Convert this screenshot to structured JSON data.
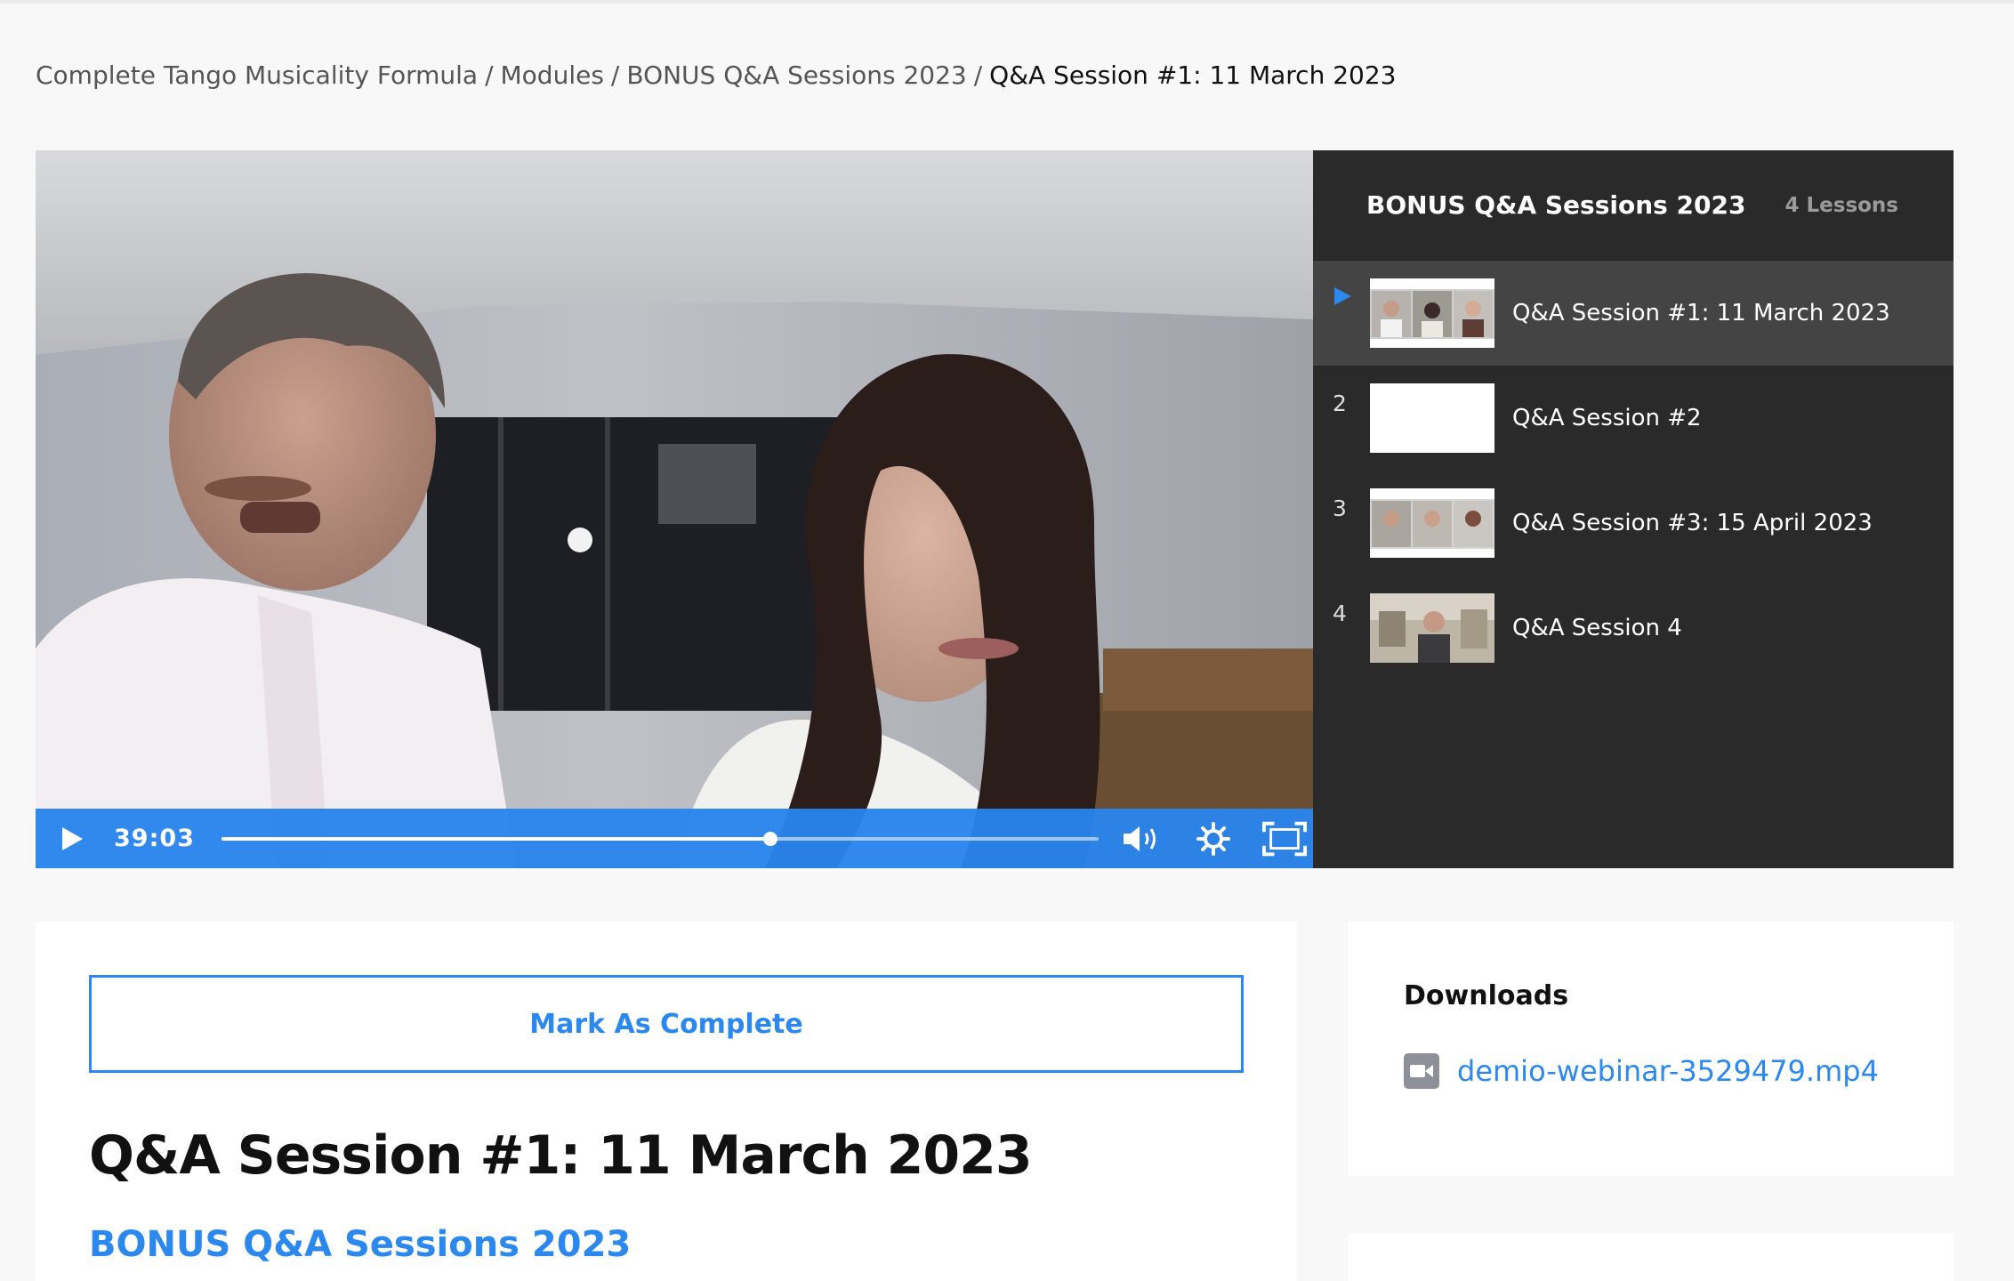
{
  "breadcrumb": {
    "items": [
      "Complete Tango Musicality Formula",
      "Modules",
      "BONUS Q&A Sessions 2023"
    ],
    "separator": "/",
    "current": "Q&A Session #1: 11 March 2023"
  },
  "player": {
    "time": "39:03",
    "progress": 0.626,
    "accent": "#2a84ec"
  },
  "playlist": {
    "title": "BONUS Q&A Sessions 2023",
    "count": "4 Lessons",
    "lessons": [
      {
        "num": "",
        "label": "Q&A Session #1: 11 March 2023",
        "active": true
      },
      {
        "num": "2",
        "label": "Q&A Session #2",
        "active": false
      },
      {
        "num": "3",
        "label": "Q&A Session #3: 15 April 2023",
        "active": false
      },
      {
        "num": "4",
        "label": "Q&A Session 4",
        "active": false
      }
    ]
  },
  "lesson": {
    "mark_complete": "Mark As Complete",
    "title": "Q&A Session #1: 11 March 2023",
    "module": "BONUS Q&A Sessions 2023"
  },
  "downloads": {
    "title": "Downloads",
    "files": [
      "demio-webinar-3529479.mp4"
    ]
  },
  "colors": {
    "accent": "#2a88ee",
    "panel": "#2a2a2a",
    "active_row": "#444444"
  },
  "icons": [
    "play-icon",
    "volume-icon",
    "settings-gear-icon",
    "fullscreen-icon",
    "now-playing-icon",
    "video-file-icon"
  ]
}
